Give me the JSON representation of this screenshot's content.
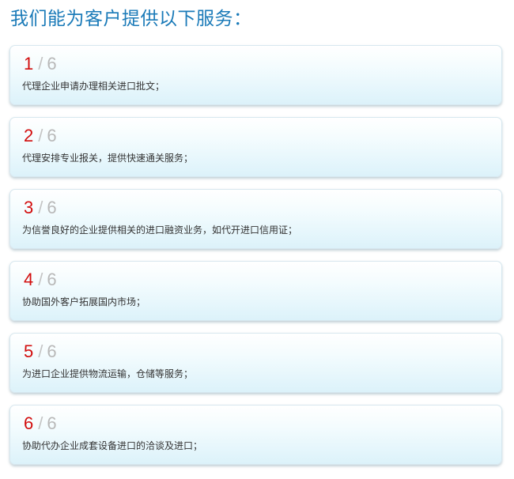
{
  "header": {
    "title": "我们能为客户提供以下服务："
  },
  "services": {
    "separator": "/",
    "total": "6",
    "items": [
      {
        "index": "1",
        "text": "代理企业申请办理相关进口批文；"
      },
      {
        "index": "2",
        "text": "代理安排专业报关，提供快速通关服务；"
      },
      {
        "index": "3",
        "text": "为信誉良好的企业提供相关的进口融资业务，如代开进口信用证；"
      },
      {
        "index": "4",
        "text": "协助国外客户拓展国内市场；"
      },
      {
        "index": "5",
        "text": "为进口企业提供物流运输，仓储等服务；"
      },
      {
        "index": "6",
        "text": "协助代办企业成套设备进口的洽谈及进口；"
      }
    ]
  },
  "colors": {
    "title": "#1a7ab8",
    "index_accent": "#d20d0d",
    "total_gray": "#b8b8b8",
    "card_gradient_bottom": "#dcf2fa"
  }
}
